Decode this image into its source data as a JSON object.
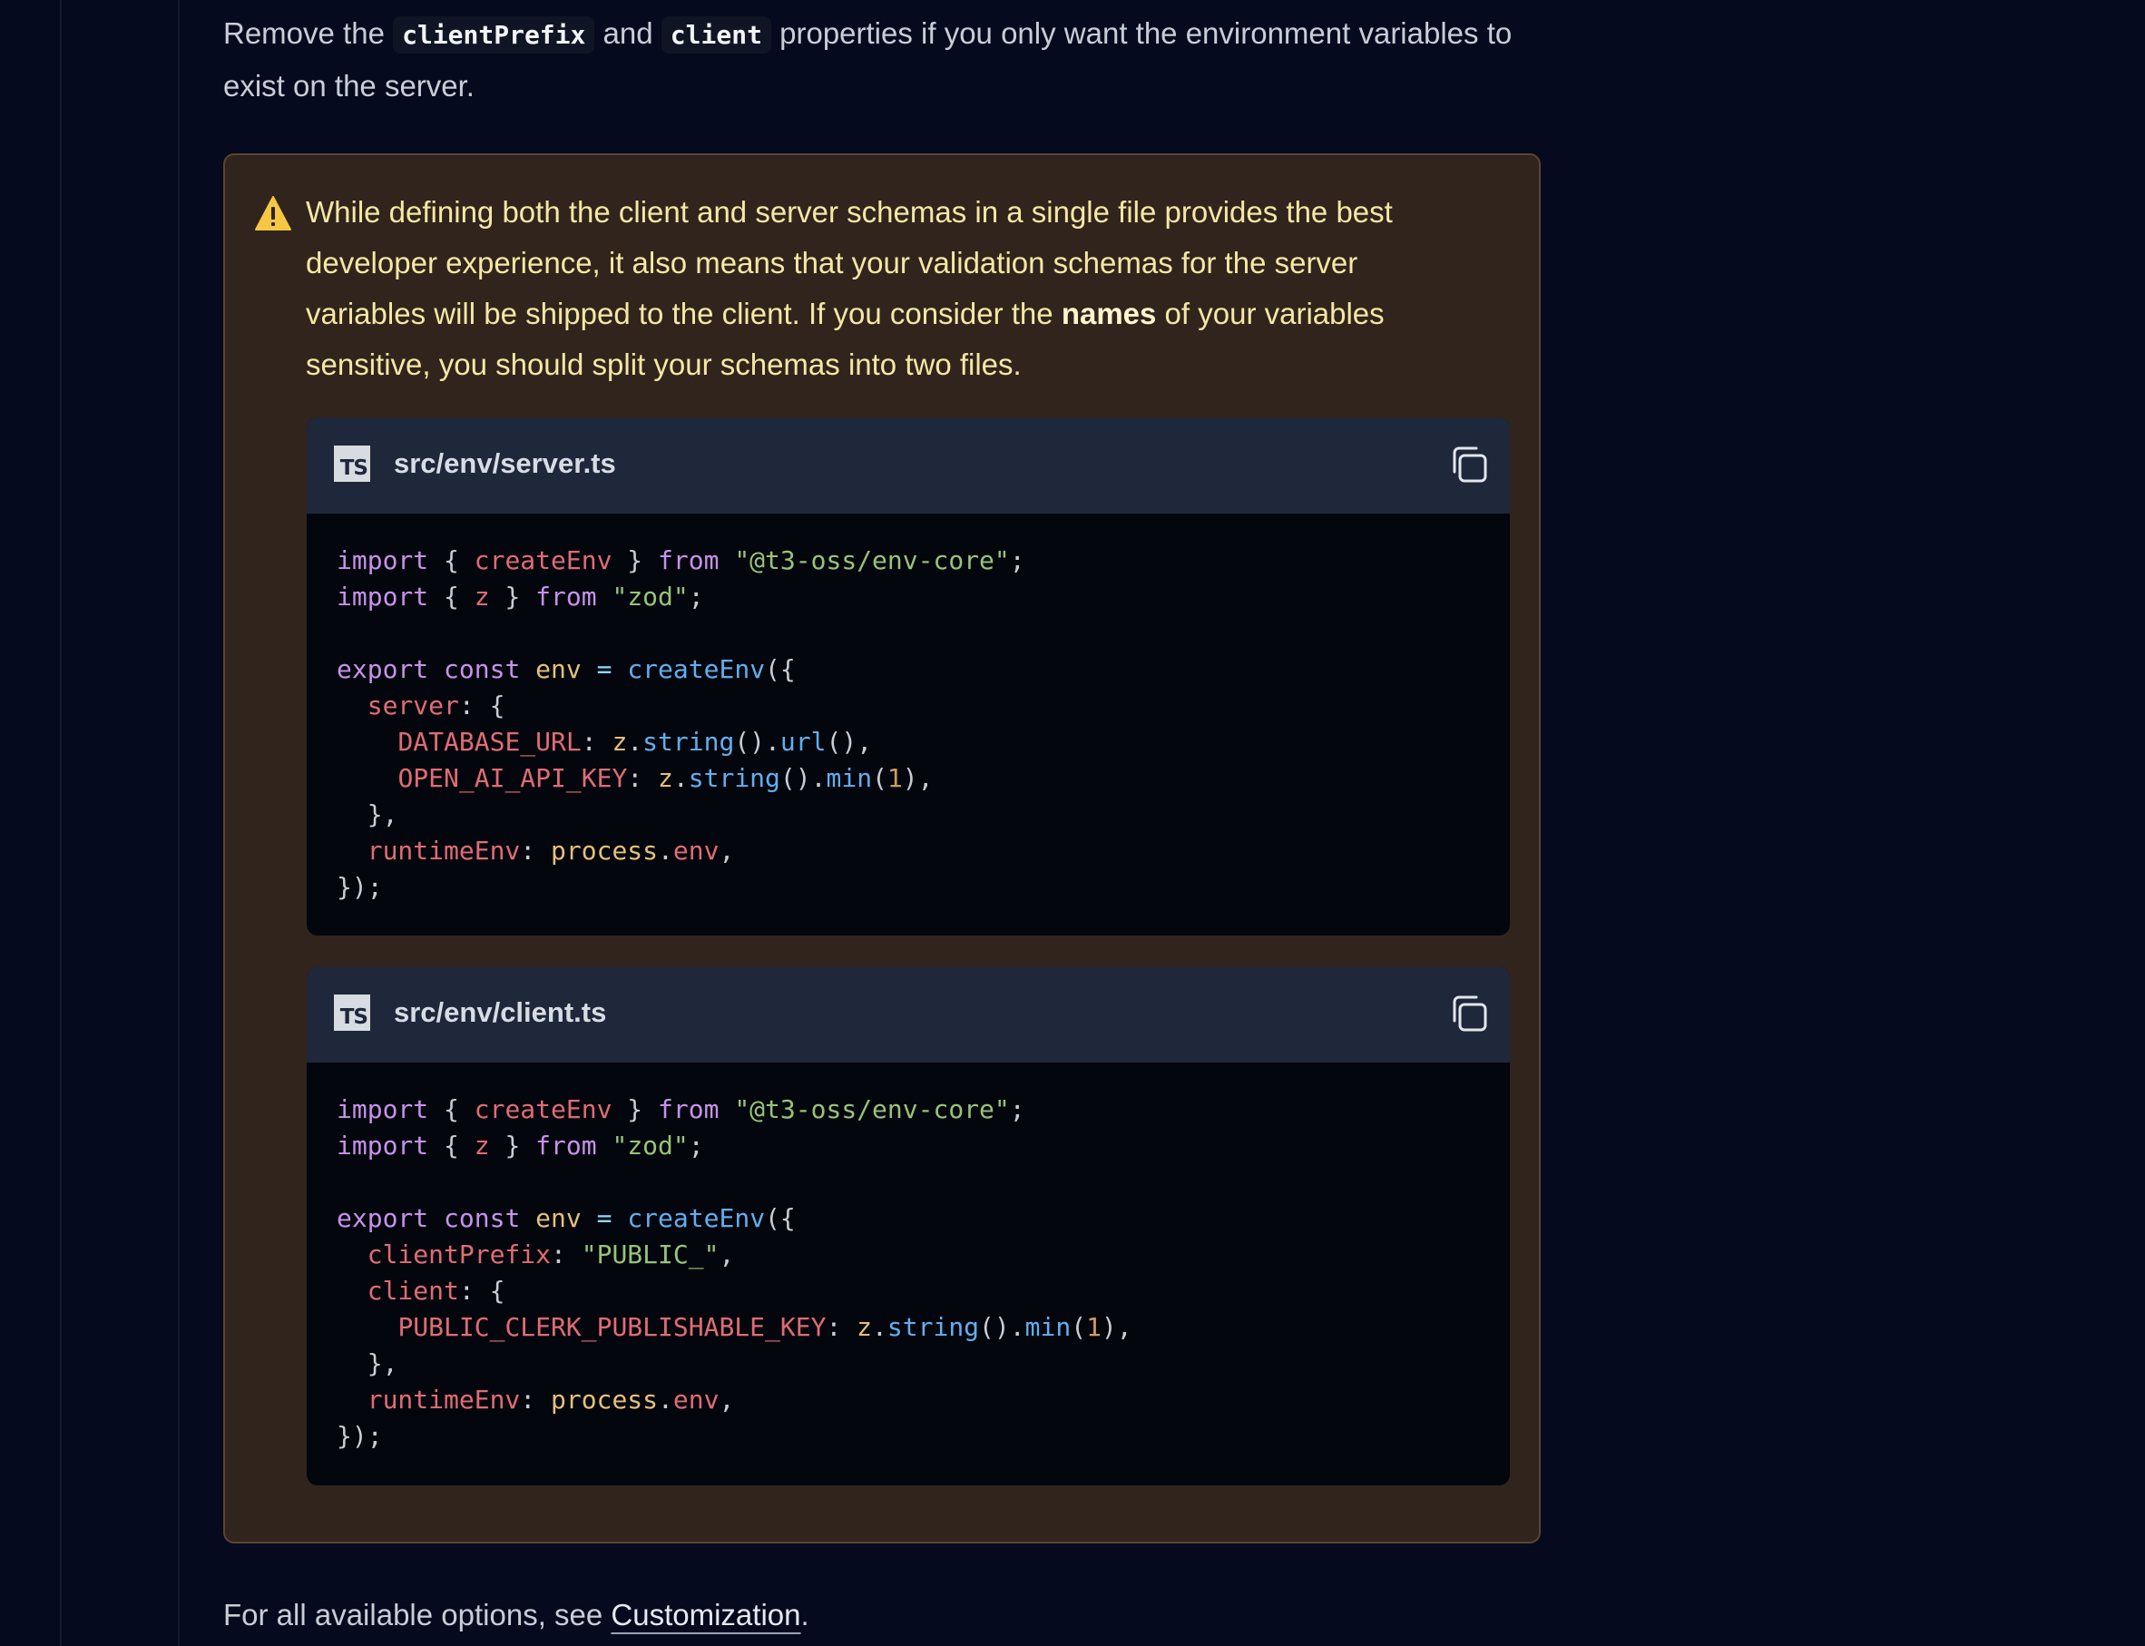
{
  "intro": {
    "text_before": "Remove the ",
    "code_1": "clientPrefix",
    "text_middle": " and ",
    "code_2": "client",
    "text_after": " properties if you only want the environment variables to exist on the server."
  },
  "callout": {
    "icon": "warning-triangle-icon",
    "text_before": "While defining both the client and server schemas in a single file provides the best developer experience, it also means that your validation schemas for the server variables will be shipped to the client. If you consider the ",
    "bold": "names",
    "text_after": " of your variables sensitive, you should split your schemas into two files.",
    "colors": {
      "background": "#31241d",
      "border": "#5a4434",
      "text": "#f4e8a4",
      "icon": "#f6c744"
    }
  },
  "code_blocks": [
    {
      "language_badge": "TS",
      "filename": "src/env/server.ts",
      "copy_icon": "copy-icon",
      "lines": [
        [
          [
            "k",
            "import"
          ],
          [
            "p",
            " { "
          ],
          [
            "v",
            "createEnv"
          ],
          [
            "p",
            " } "
          ],
          [
            "k",
            "from"
          ],
          [
            "p",
            " "
          ],
          [
            "s",
            "\"@t3-oss/env-core\""
          ],
          [
            "p",
            ";"
          ]
        ],
        [
          [
            "k",
            "import"
          ],
          [
            "p",
            " { "
          ],
          [
            "v",
            "z"
          ],
          [
            "p",
            " } "
          ],
          [
            "k",
            "from"
          ],
          [
            "p",
            " "
          ],
          [
            "s",
            "\"zod\""
          ],
          [
            "p",
            ";"
          ]
        ],
        [],
        [
          [
            "k",
            "export"
          ],
          [
            "p",
            " "
          ],
          [
            "k",
            "const"
          ],
          [
            "p",
            " "
          ],
          [
            "y",
            "env"
          ],
          [
            "p",
            " "
          ],
          [
            "o",
            "="
          ],
          [
            "p",
            " "
          ],
          [
            "f",
            "createEnv"
          ],
          [
            "p",
            "({"
          ]
        ],
        [
          [
            "p",
            "  "
          ],
          [
            "v",
            "server"
          ],
          [
            "p",
            ": {"
          ]
        ],
        [
          [
            "p",
            "    "
          ],
          [
            "v",
            "DATABASE_URL"
          ],
          [
            "p",
            ": "
          ],
          [
            "y",
            "z"
          ],
          [
            "p",
            "."
          ],
          [
            "f",
            "string"
          ],
          [
            "p",
            "()."
          ],
          [
            "f",
            "url"
          ],
          [
            "p",
            "(),"
          ]
        ],
        [
          [
            "p",
            "    "
          ],
          [
            "v",
            "OPEN_AI_API_KEY"
          ],
          [
            "p",
            ": "
          ],
          [
            "y",
            "z"
          ],
          [
            "p",
            "."
          ],
          [
            "f",
            "string"
          ],
          [
            "p",
            "()."
          ],
          [
            "f",
            "min"
          ],
          [
            "p",
            "("
          ],
          [
            "n",
            "1"
          ],
          [
            "p",
            "),"
          ]
        ],
        [
          [
            "p",
            "  },"
          ]
        ],
        [
          [
            "p",
            "  "
          ],
          [
            "v",
            "runtimeEnv"
          ],
          [
            "p",
            ": "
          ],
          [
            "y",
            "process"
          ],
          [
            "p",
            "."
          ],
          [
            "v",
            "env"
          ],
          [
            "p",
            ","
          ]
        ],
        [
          [
            "p",
            "});"
          ]
        ]
      ]
    },
    {
      "language_badge": "TS",
      "filename": "src/env/client.ts",
      "copy_icon": "copy-icon",
      "lines": [
        [
          [
            "k",
            "import"
          ],
          [
            "p",
            " { "
          ],
          [
            "v",
            "createEnv"
          ],
          [
            "p",
            " } "
          ],
          [
            "k",
            "from"
          ],
          [
            "p",
            " "
          ],
          [
            "s",
            "\"@t3-oss/env-core\""
          ],
          [
            "p",
            ";"
          ]
        ],
        [
          [
            "k",
            "import"
          ],
          [
            "p",
            " { "
          ],
          [
            "v",
            "z"
          ],
          [
            "p",
            " } "
          ],
          [
            "k",
            "from"
          ],
          [
            "p",
            " "
          ],
          [
            "s",
            "\"zod\""
          ],
          [
            "p",
            ";"
          ]
        ],
        [],
        [
          [
            "k",
            "export"
          ],
          [
            "p",
            " "
          ],
          [
            "k",
            "const"
          ],
          [
            "p",
            " "
          ],
          [
            "y",
            "env"
          ],
          [
            "p",
            " "
          ],
          [
            "o",
            "="
          ],
          [
            "p",
            " "
          ],
          [
            "f",
            "createEnv"
          ],
          [
            "p",
            "({"
          ]
        ],
        [
          [
            "p",
            "  "
          ],
          [
            "v",
            "clientPrefix"
          ],
          [
            "p",
            ": "
          ],
          [
            "s",
            "\"PUBLIC_\""
          ],
          [
            "p",
            ","
          ]
        ],
        [
          [
            "p",
            "  "
          ],
          [
            "v",
            "client"
          ],
          [
            "p",
            ": {"
          ]
        ],
        [
          [
            "p",
            "    "
          ],
          [
            "v",
            "PUBLIC_CLERK_PUBLISHABLE_KEY"
          ],
          [
            "p",
            ": "
          ],
          [
            "y",
            "z"
          ],
          [
            "p",
            "."
          ],
          [
            "f",
            "string"
          ],
          [
            "p",
            "()."
          ],
          [
            "f",
            "min"
          ],
          [
            "p",
            "("
          ],
          [
            "n",
            "1"
          ],
          [
            "p",
            "),"
          ]
        ],
        [
          [
            "p",
            "  },"
          ]
        ],
        [
          [
            "p",
            "  "
          ],
          [
            "v",
            "runtimeEnv"
          ],
          [
            "p",
            ": "
          ],
          [
            "y",
            "process"
          ],
          [
            "p",
            "."
          ],
          [
            "v",
            "env"
          ],
          [
            "p",
            ","
          ]
        ],
        [
          [
            "p",
            "});"
          ]
        ]
      ]
    }
  ],
  "outro": {
    "text_before": "For all available options, see ",
    "link": "Customization",
    "text_after": "."
  }
}
